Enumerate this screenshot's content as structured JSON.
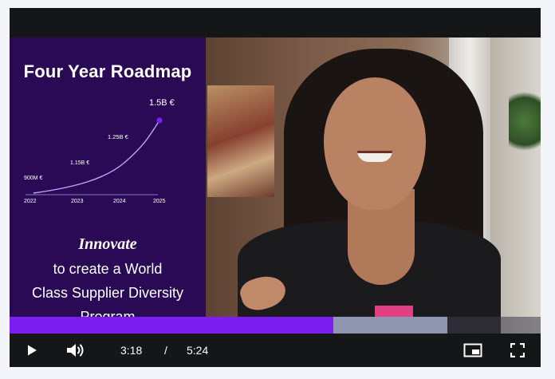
{
  "slide": {
    "title": "Four Year Roadmap",
    "chart": {
      "years": [
        "2022",
        "2023",
        "2024",
        "2025"
      ],
      "values": [
        "900M €",
        "1.15B €",
        "1.25B €",
        "1.5B €"
      ]
    },
    "tagline_italic": "Innovate",
    "tagline_lines": [
      "to create a World",
      "Class Supplier Diversity",
      "Program"
    ]
  },
  "player": {
    "progress": {
      "played_fraction": 0.61,
      "buffered_fraction": 0.825
    },
    "current_time": "3:18",
    "separator": "/",
    "duration": "5:24",
    "icons": {
      "play": "play-icon",
      "volume": "volume-icon",
      "pip": "picture-in-picture-icon",
      "fullscreen": "fullscreen-icon"
    },
    "colors": {
      "accent": "#7b1ef0",
      "buffered": "#8e96b0",
      "bar": "#141617"
    }
  }
}
